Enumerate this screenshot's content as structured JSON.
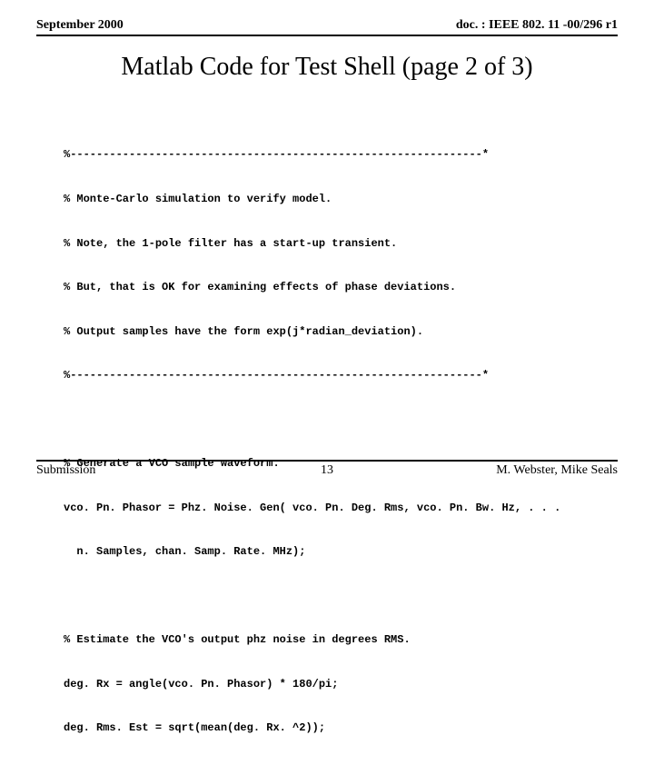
{
  "header": {
    "date": "September 2000",
    "doc": "doc. : IEEE 802. 11 -00/296 r1"
  },
  "title": "Matlab Code for Test Shell (page 2 of 3)",
  "blocks": [
    {
      "lines": [
        "%---------------------------------------------------------------*",
        "% Monte-Carlo simulation to verify model.",
        "% Note, the 1-pole filter has a start-up transient.",
        "% But, that is OK for examining effects of phase deviations.",
        "% Output samples have the form exp(j*radian_deviation).",
        "%---------------------------------------------------------------*"
      ]
    },
    {
      "lines": [
        "% Generate a VCO sample waveform.",
        "vco. Pn. Phasor = Phz. Noise. Gen( vco. Pn. Deg. Rms, vco. Pn. Bw. Hz, . . .",
        "  n. Samples, chan. Samp. Rate. MHz);"
      ]
    },
    {
      "lines": [
        "% Estimate the VCO's output phz noise in degrees RMS.",
        "deg. Rx = angle(vco. Pn. Phasor) * 180/pi;",
        "deg. Rms. Est = sqrt(mean(deg. Rx. ^2));"
      ]
    }
  ],
  "footer": {
    "left": "Submission",
    "center": "13",
    "right": "M. Webster, Mike Seals"
  }
}
